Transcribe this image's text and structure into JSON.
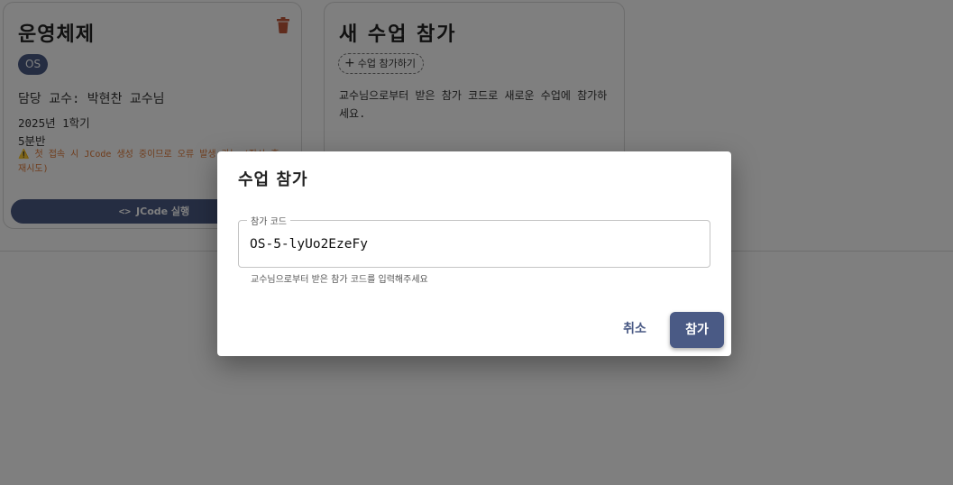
{
  "course_card": {
    "title": "운영체제",
    "code_badge": "OS",
    "professor": "담당 교수: 박현찬 교수님",
    "term": "2025년 1학기",
    "section": "5분반",
    "warning": "⚠️ 첫 접속 시 JCode 생성 중이므로 오류 발생 가능 (잠시 후 재시도)",
    "run_glyph": "<>",
    "run_label": "JCode 실행",
    "delete_icon": "trash-icon"
  },
  "join_card": {
    "title": "새 수업 참가",
    "chip_label": "수업 참가하기",
    "description": "교수님으로부터 받은 참가 코드로 새로운 수업에 참가하세요."
  },
  "dialog": {
    "title": "수업 참가",
    "field_label": "참가 코드",
    "field_value": "OS-5-lyUo2EzeFy",
    "helper_text": "교수님으로부터 받은 참가 코드를 입력해주세요",
    "cancel_label": "취소",
    "submit_label": "참가"
  },
  "colors": {
    "primary": "#4a5a85",
    "warning": "#e07b39",
    "danger": "#c0583a"
  }
}
